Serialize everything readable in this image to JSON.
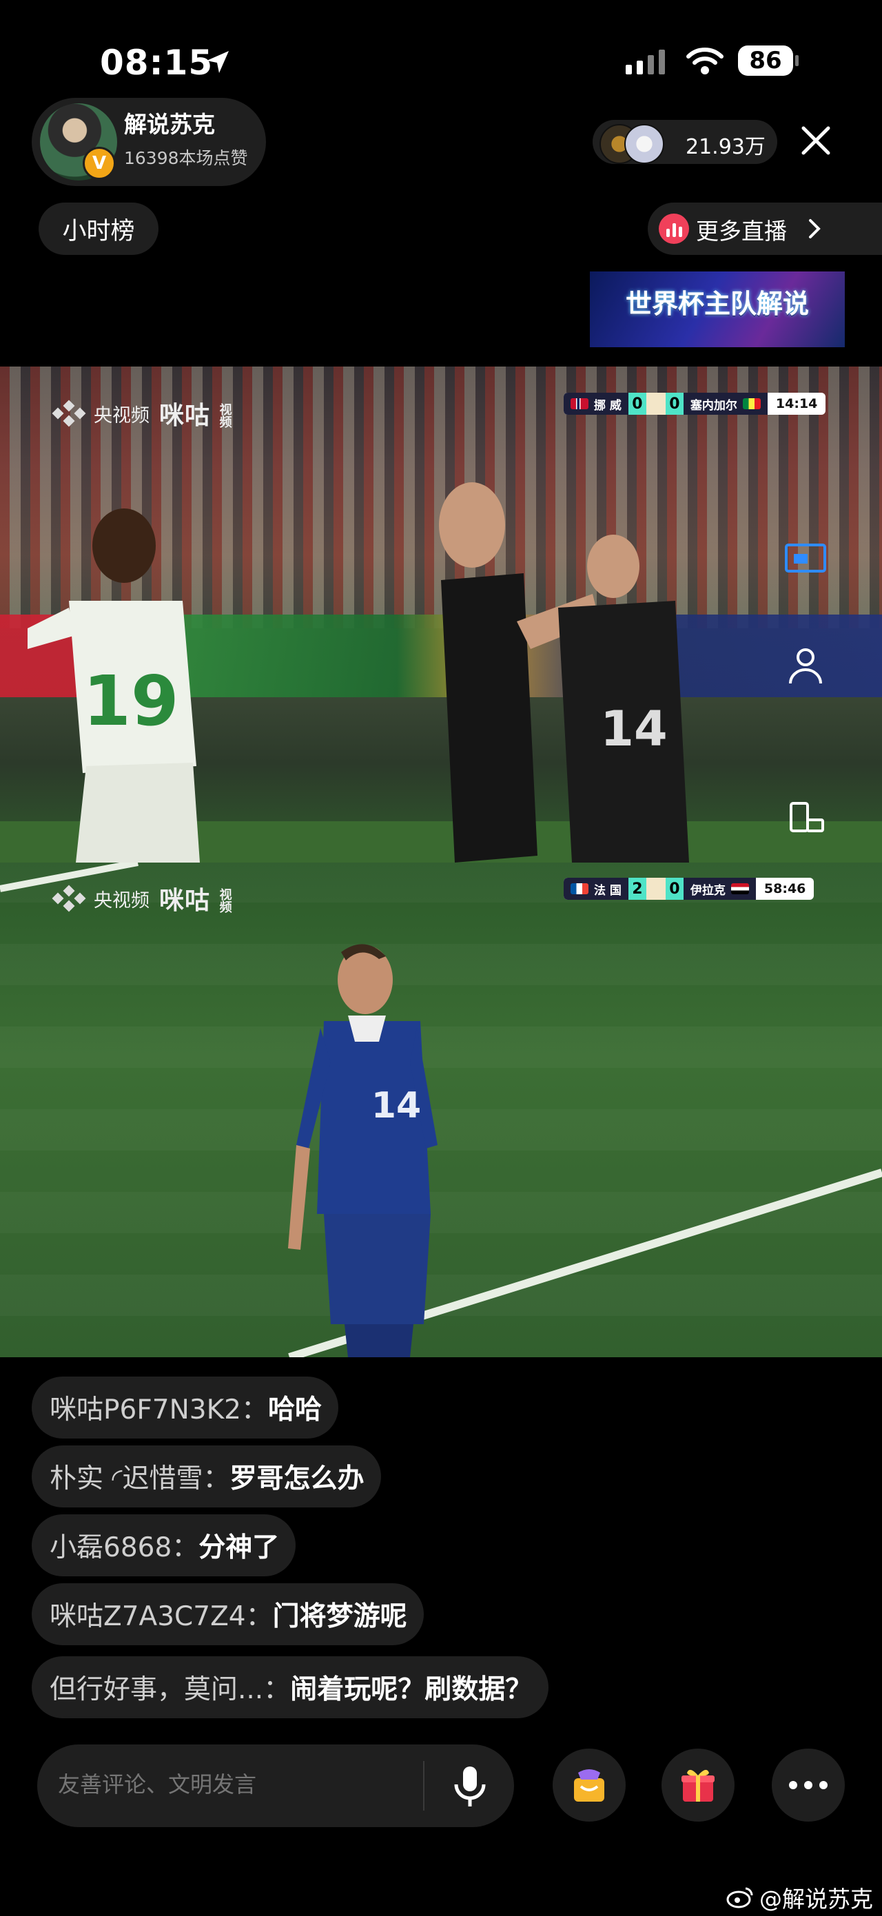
{
  "status_bar": {
    "time": "08:15",
    "battery": "86"
  },
  "host": {
    "name": "解说苏克",
    "likes": "16398本场点赞",
    "badge": "V"
  },
  "viewers": {
    "count": "21.93万"
  },
  "rank_label": "小时榜",
  "more_live_label": "更多直播",
  "banner_text": "世界杯主队解说",
  "broadcast": {
    "cctv_label": "央视频",
    "migu_label": "咪咕",
    "migu_small": "视频"
  },
  "match1": {
    "team1": "挪 威",
    "score1": "0",
    "score2": "0",
    "team2": "塞内加尔",
    "clock": "14:14",
    "jersey_white": "19",
    "jersey_black": "14"
  },
  "match2": {
    "team1": "法 国",
    "score1": "2",
    "score2": "0",
    "team2": "伊拉克",
    "clock": "58:46",
    "jersey_blue": "14"
  },
  "comments": [
    {
      "user": "咪咕P6F7N3K2：",
      "text": "哈哈"
    },
    {
      "user": "朴实 ◜迟惜雪：",
      "text": "罗哥怎么办"
    },
    {
      "user": "小磊6868：",
      "text": "分神了"
    },
    {
      "user": "咪咕Z7A3C7Z4：",
      "text": "门将梦游呢"
    },
    {
      "user": "但行好事，莫问...：",
      "text": "闹着玩呢？刷数据？"
    }
  ],
  "input": {
    "placeholder": "友善评论、文明发言"
  },
  "watermark": "@解说苏克",
  "icons": [
    "location-arrow-icon",
    "signal-icon",
    "wifi-icon",
    "close-icon",
    "chart-icon",
    "chevron-right-icon",
    "pip-icon",
    "person-icon",
    "rotate-icon",
    "mic-icon",
    "gift-bag-icon",
    "gift-box-icon",
    "more-icon",
    "weibo-icon"
  ]
}
